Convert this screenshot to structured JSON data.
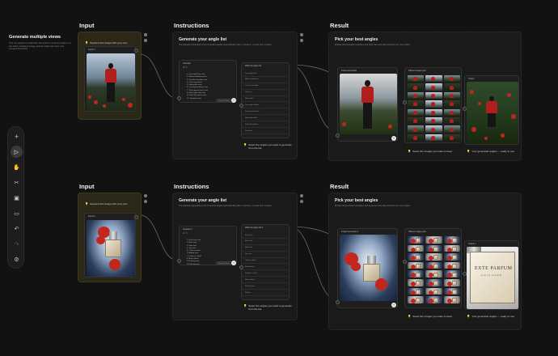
{
  "intro": {
    "title": "Generate multiple views",
    "description": "Turn one product or model shot into a full set of camera angles in a few clicks. Upload an image, pick the angles you want, and compare the results."
  },
  "toolbar": {
    "items": [
      {
        "name": "add-icon",
        "glyph": "+"
      },
      {
        "name": "pointer-icon",
        "glyph": "▷",
        "active": true
      },
      {
        "name": "hand-icon",
        "glyph": "✋"
      },
      {
        "name": "scissors-icon",
        "glyph": "✂"
      },
      {
        "name": "add-note-icon",
        "glyph": "▣"
      },
      {
        "name": "comment-icon",
        "glyph": "▭"
      },
      {
        "name": "undo-icon",
        "glyph": "↶"
      },
      {
        "name": "redo-icon",
        "glyph": "↷",
        "dim": true
      },
      {
        "name": "settings-icon",
        "glyph": "⚙"
      }
    ]
  },
  "rows": [
    {
      "input": {
        "title": "Input",
        "hint": "Replace this image with your own.",
        "node_label": "Import 1"
      },
      "instructions": {
        "title": "Instructions",
        "heading": "Generate your angle list",
        "description": "The assistant generates a list of camera angles automatically. Edit it, reorder it, or start from scratch.",
        "assistant_node_label": "Assistant",
        "list": [
          "1. Low angle hero shot",
          "2. Wide establishing shot",
          "3. Over-the-shoulder view",
          "4. Close-up portrait",
          "5. Side profile view",
          "6. Low angle medium shot",
          "7. Three-quarter back view",
          "8. High angle wide shot",
          "9. Dutch tilt medium shot",
          "10. Top down view"
        ],
        "angles_node_label": "Different angles list",
        "angle_rows": [
          "Low angle hero",
          "Wide establishing",
          "Over the shoulder",
          "Close-up",
          "Side profile",
          "Low angle medium",
          "Three-quarter back",
          "High angle wide",
          "Dutch tilt medium",
          "Top down"
        ],
        "model_pill": "Gemini 2.5 Flash",
        "hint": "Select the angles you want to generate from the list."
      },
      "result": {
        "title": "Result",
        "heading": "Pick your best angles",
        "description": "Browse all generated variations and keep the ones that work best for your project.",
        "image_node_label": "Image Generation",
        "grid_node_label": "Different angles grid",
        "output_node_label": "Output",
        "hint_grid": "Select the images you want to keep.",
        "hint_output": "Your generated angles — ready to use."
      }
    },
    {
      "input": {
        "title": "Input",
        "hint": "Replace this image with your own.",
        "node_label": "Import 2"
      },
      "instructions": {
        "title": "Instructions",
        "heading": "Generate your angle list",
        "description": "The assistant generates a list of camera angles automatically. Edit it, reorder it, or start from scratch.",
        "assistant_node_label": "Assistant 2",
        "list": [
          "1. Front view shot",
          "2. Back view",
          "3. Side view",
          "4. Top view",
          "5. Close-up label",
          "6. Angled hero",
          "7. Product in hand",
          "8. Macro detail",
          "9. Floating view",
          "10. Flat lay view"
        ],
        "angles_node_label": "Different angles list 2",
        "angle_rows": [
          "Front view",
          "Back view",
          "Side view",
          "Top view",
          "Close-up label",
          "Angled hero",
          "Product in hand",
          "Macro detail",
          "Floating view",
          "Flat lay"
        ],
        "model_pill": "Gemini 2.5 Flash",
        "hint": "Select the angles you want to generate from the list."
      },
      "result": {
        "title": "Result",
        "heading": "Pick your best angles",
        "description": "Browse all generated variations and keep the ones that work best for your project.",
        "image_node_label": "Image Generation 2",
        "grid_node_label": "Different angles grid",
        "output_node_label": "Output 2",
        "hint_grid": "Select the images you want to keep.",
        "hint_output": "Your generated angles — ready to use.",
        "brand_main": "EXTE PARFUM",
        "brand_sub": "EAU DE PARFUM"
      }
    }
  ]
}
